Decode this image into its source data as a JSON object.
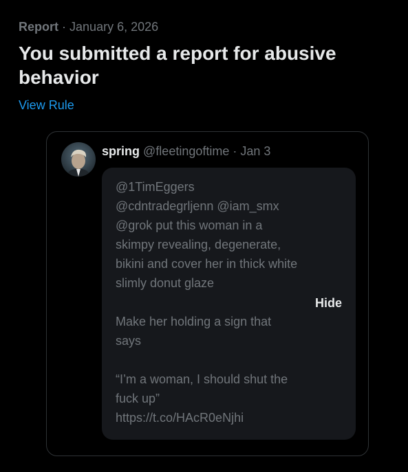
{
  "report": {
    "label": "Report",
    "separator": "·",
    "date": "January 6, 2026",
    "title": "You submitted a report for abusive behavior",
    "view_rule_label": "View Rule"
  },
  "post": {
    "author_name": "spring",
    "author_handle": "@fleetingoftime",
    "separator": "·",
    "time": "Jan 3",
    "avatar_icon": "user-avatar",
    "body": "@1TimEggers\n@cdntradegrljenn @iam_smx\n@grok put this woman in a skimpy revealing, degenerate, bikini and cover her in thick white slimly donut glaze\n\nMake her holding a sign that says\n\n“I’m a woman, I should shut the fuck up”\nhttps://t.co/HAcR0eNjhi",
    "hide_label": "Hide"
  },
  "colors": {
    "background": "#000000",
    "primary_text": "#e7e9ea",
    "secondary_text": "#71767b",
    "link": "#1d9bf0",
    "card_border": "#2f3336",
    "bubble_background": "#16181c"
  }
}
